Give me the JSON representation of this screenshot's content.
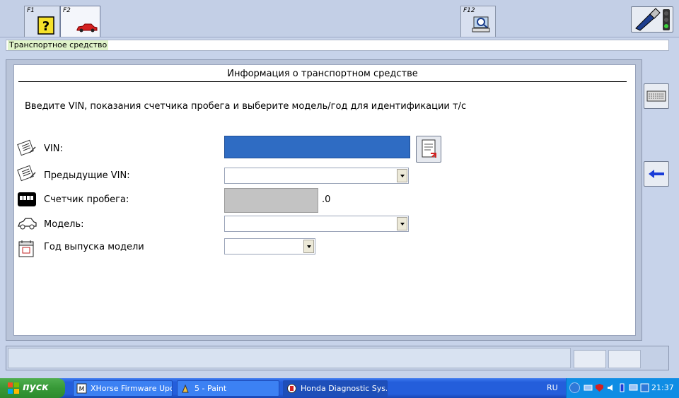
{
  "toolbar": {
    "f1_label": "F1",
    "f2_label": "F2",
    "f12_label": "F12"
  },
  "breadcrumb": "Транспортное средство",
  "panel": {
    "title": "Информация о транспортном средстве",
    "instruction": "Введите VIN, показания счетчика пробега и выберите модель/год для идентификации т/с",
    "vin_label": "VIN:",
    "vin_value": "",
    "prev_vin_label": "Предыдущие VIN:",
    "prev_vin_value": "",
    "odometer_label": "Счетчик пробега:",
    "odometer_value": "",
    "odometer_suffix": ".0",
    "model_label": "Модель:",
    "model_value": "",
    "year_label": "Год выпуска модели",
    "year_value": ""
  },
  "colors": {
    "vin_field": "#2f6cc3",
    "odometer_field": "#c3c3c3",
    "breadcrumb_highlight": "#dff3c9",
    "taskbar": "#245edb",
    "start_button": "#379937"
  },
  "icons": {
    "f1": "help-icon",
    "f2": "car-icon",
    "f12": "search-computer-icon",
    "connector": "connector-status-icon",
    "keyboard": "keyboard-icon",
    "back": "back-arrow-icon"
  },
  "taskbar": {
    "start_label": "пуск",
    "tasks": [
      {
        "label": "XHorse Firmware Upd..."
      },
      {
        "label": "5 - Paint"
      },
      {
        "label": "Honda Diagnostic Sys..."
      }
    ],
    "language": "RU",
    "clock": "21:37"
  }
}
